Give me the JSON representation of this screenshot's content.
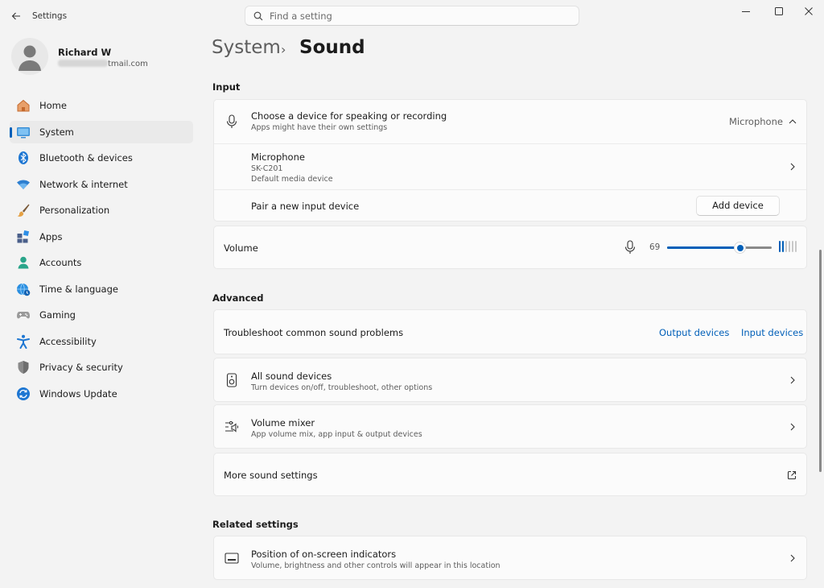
{
  "window": {
    "title": "Settings",
    "search_placeholder": "Find a setting"
  },
  "profile": {
    "name": "Richard W",
    "email_suffix": "tmail.com"
  },
  "nav": {
    "items": [
      {
        "label": "Home",
        "icon": "home-icon"
      },
      {
        "label": "System",
        "icon": "system-icon",
        "selected": true
      },
      {
        "label": "Bluetooth & devices",
        "icon": "bluetooth-icon"
      },
      {
        "label": "Network & internet",
        "icon": "network-icon"
      },
      {
        "label": "Personalization",
        "icon": "brush-icon"
      },
      {
        "label": "Apps",
        "icon": "apps-icon"
      },
      {
        "label": "Accounts",
        "icon": "accounts-icon"
      },
      {
        "label": "Time & language",
        "icon": "globe-clock-icon"
      },
      {
        "label": "Gaming",
        "icon": "gamepad-icon"
      },
      {
        "label": "Accessibility",
        "icon": "accessibility-icon"
      },
      {
        "label": "Privacy & security",
        "icon": "shield-icon"
      },
      {
        "label": "Windows Update",
        "icon": "update-icon"
      }
    ]
  },
  "breadcrumb": {
    "parent": "System",
    "separator": "›",
    "current": "Sound"
  },
  "input": {
    "section_title": "Input",
    "choose_title": "Choose a device for speaking or recording",
    "choose_subtitle": "Apps might have their own settings",
    "choose_value": "Microphone",
    "device_name": "Microphone",
    "device_model": "SK-C201",
    "device_status": "Default media device",
    "pair_label": "Pair a new input device",
    "add_button": "Add device",
    "volume_label": "Volume",
    "volume_value": "69",
    "volume_level": 0.69,
    "meter_bars_active": 2,
    "meter_bars_total": 6,
    "accent_color": "#005fb8"
  },
  "advanced": {
    "section_title": "Advanced",
    "troubleshoot_label": "Troubleshoot common sound problems",
    "output_link": "Output devices",
    "input_link": "Input devices",
    "all_devices_title": "All sound devices",
    "all_devices_subtitle": "Turn devices on/off, troubleshoot, other options",
    "mixer_title": "Volume mixer",
    "mixer_subtitle": "App volume mix, app input & output devices",
    "more_settings": "More sound settings"
  },
  "related": {
    "section_title": "Related settings",
    "indicator_title": "Position of on-screen indicators",
    "indicator_subtitle": "Volume, brightness and other controls will appear in this location"
  }
}
